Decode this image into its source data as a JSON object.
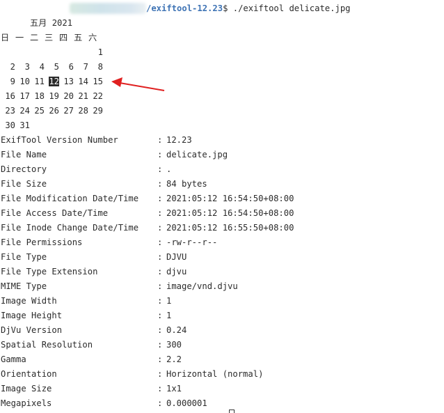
{
  "prompt": {
    "path": "/exiftool-12.23",
    "command": "$ ./exiftool delicate.jpg"
  },
  "calendar": {
    "title": "五月 2021",
    "weekdays": [
      "日",
      "一",
      "二",
      "三",
      "四",
      "五",
      "六"
    ],
    "weeks": [
      [
        "",
        "",
        "",
        "",
        "",
        "",
        "1"
      ],
      [
        "2",
        "3",
        "4",
        "5",
        "6",
        "7",
        "8"
      ],
      [
        "9",
        "10",
        "11",
        "12",
        "13",
        "14",
        "15"
      ],
      [
        "16",
        "17",
        "18",
        "19",
        "20",
        "21",
        "22"
      ],
      [
        "23",
        "24",
        "25",
        "26",
        "27",
        "28",
        "29"
      ],
      [
        "30",
        "31",
        "",
        "",
        "",
        "",
        ""
      ]
    ],
    "highlighted": "12"
  },
  "annotation": {
    "arrow_color": "#e02020",
    "icon": "red-arrow-icon"
  },
  "exif": [
    {
      "key": "ExifTool Version Number",
      "value": "12.23"
    },
    {
      "key": "File Name",
      "value": "delicate.jpg"
    },
    {
      "key": "Directory",
      "value": "."
    },
    {
      "key": "File Size",
      "value": "84 bytes"
    },
    {
      "key": "File Modification Date/Time",
      "value": "2021:05:12 16:54:50+08:00"
    },
    {
      "key": "File Access Date/Time",
      "value": "2021:05:12 16:54:50+08:00"
    },
    {
      "key": "File Inode Change Date/Time",
      "value": "2021:05:12 16:55:50+08:00"
    },
    {
      "key": "File Permissions",
      "value": "-rw-r--r--"
    },
    {
      "key": "File Type",
      "value": "DJVU"
    },
    {
      "key": "File Type Extension",
      "value": "djvu"
    },
    {
      "key": "MIME Type",
      "value": "image/vnd.djvu"
    },
    {
      "key": "Image Width",
      "value": "1"
    },
    {
      "key": "Image Height",
      "value": "1"
    },
    {
      "key": "DjVu Version",
      "value": "0.24"
    },
    {
      "key": "Spatial Resolution",
      "value": "300"
    },
    {
      "key": "Gamma",
      "value": "2.2"
    },
    {
      "key": "Orientation",
      "value": "Horizontal (normal)"
    },
    {
      "key": "Image Size",
      "value": "1x1"
    },
    {
      "key": "Megapixels",
      "value": "0.000001"
    }
  ],
  "separator": ":"
}
